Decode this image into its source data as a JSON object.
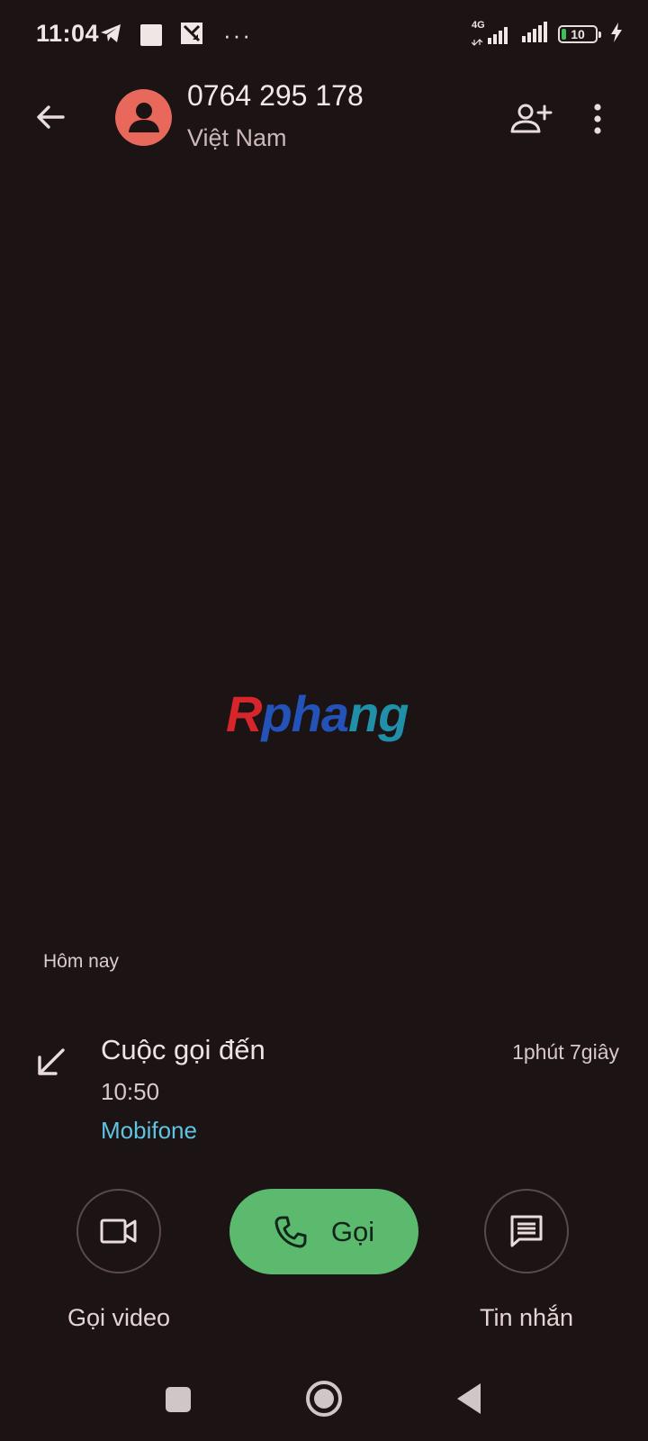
{
  "status_bar": {
    "time": "11:04",
    "network": "4G",
    "battery_level": "10",
    "more": "···",
    "icons": [
      "telegram-icon",
      "square-notification-icon",
      "app-notification-icon",
      "signal-4g-icon",
      "signal-icon",
      "battery-icon",
      "charging-icon"
    ]
  },
  "header": {
    "back_icon": "arrow-left-icon",
    "phone_number": "0764 295 178",
    "country": "Việt Nam",
    "avatar_color": "#e8685c",
    "actions": [
      "add-contact-icon",
      "more-vert-icon"
    ]
  },
  "watermark": {
    "part_a": "R",
    "part_b": "pha",
    "part_c": "ng"
  },
  "call_history": {
    "section_label": "Hôm nay",
    "entry": {
      "type": "Cuộc gọi đến",
      "time": "10:50",
      "carrier": "Mobifone",
      "duration": "1phút 7giây",
      "direction_icon": "incoming-call-arrow-icon"
    }
  },
  "actions": {
    "video_label": "Gọi video",
    "call_label": "Gọi",
    "message_label": "Tin nhắn",
    "call_color": "#5cba6f"
  },
  "nav_bar": {
    "icons": [
      "recents-icon",
      "home-icon",
      "back-icon"
    ]
  }
}
